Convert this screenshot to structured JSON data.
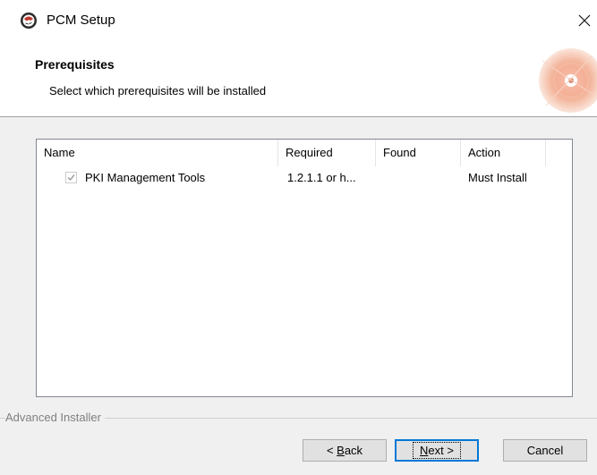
{
  "window": {
    "title": "PCM Setup",
    "close_label": "✕"
  },
  "header": {
    "title": "Prerequisites",
    "subtitle": "Select which prerequisites will be installed"
  },
  "list": {
    "columns": [
      "Name",
      "Required",
      "Found",
      "Action"
    ],
    "rows": [
      {
        "checked": true,
        "name": "PKI Management Tools",
        "required": "1.2.1.1 or h...",
        "found": "",
        "action": "Must Install"
      }
    ]
  },
  "footer": {
    "brand": "Advanced Installer",
    "back_prefix": "< ",
    "back_mnemonic": "B",
    "back_rest": "ack",
    "next_mnemonic": "N",
    "next_rest": "ext >",
    "cancel_label": "Cancel"
  },
  "colors": {
    "accent": "#0078d7",
    "background": "#f0f0f0",
    "header_bg": "#ffffff"
  },
  "icons": {
    "app": "setup-globe-icon",
    "header_art": "disc-art-icon",
    "close": "close-icon",
    "checkbox": "checkmark-icon"
  }
}
